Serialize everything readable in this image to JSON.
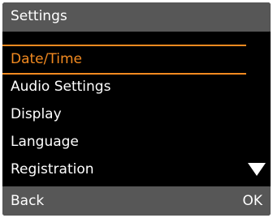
{
  "header": {
    "title": "Settings"
  },
  "menu": {
    "items": [
      {
        "label": "Date/Time",
        "selected": true
      },
      {
        "label": "Audio Settings",
        "selected": false
      },
      {
        "label": "Display",
        "selected": false
      },
      {
        "label": "Language",
        "selected": false
      },
      {
        "label": "Registration",
        "selected": false
      }
    ],
    "more_indicator": "down-triangle-icon"
  },
  "softkeys": {
    "left_label": "Back",
    "right_label": "OK"
  },
  "colors": {
    "bar_background": "#575757",
    "screen_background": "#000000",
    "highlight": "#f28a20",
    "text": "#ffffff"
  }
}
